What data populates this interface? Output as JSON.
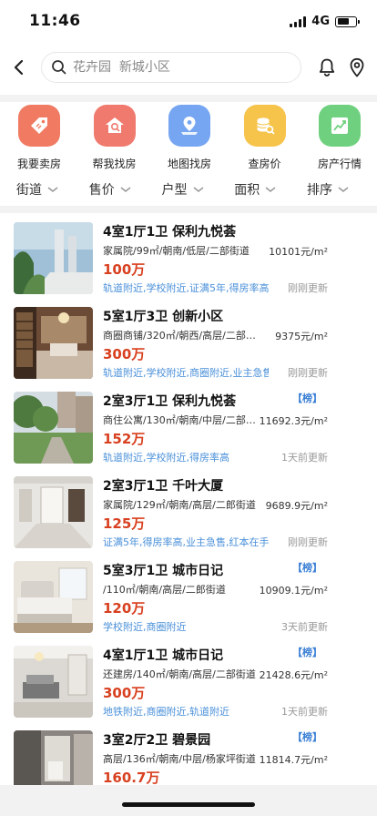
{
  "status_bar": {
    "time": "11:46",
    "network": "4G"
  },
  "header": {
    "search_placeholder": "花卉园  新城小区"
  },
  "categories": [
    {
      "label": "我要卖房",
      "icon": "sell-tag-icon",
      "color": "#f07a62"
    },
    {
      "label": "帮我找房",
      "icon": "house-search-icon",
      "color": "#f07a6e"
    },
    {
      "label": "地图找房",
      "icon": "map-pin-icon",
      "color": "#76a6f2"
    },
    {
      "label": "查房价",
      "icon": "coins-search-icon",
      "color": "#f6c34b"
    },
    {
      "label": "房产行情",
      "icon": "trend-chart-icon",
      "color": "#6fd17f"
    }
  ],
  "filters": [
    {
      "label": "街道"
    },
    {
      "label": "售价"
    },
    {
      "label": "户型"
    },
    {
      "label": "面积"
    },
    {
      "label": "排序"
    }
  ],
  "listings": [
    {
      "title": "4室1厅1卫  保利九悦荟",
      "details": "家属院/99㎡/朝南/低层/二部街道",
      "unit_price": "10101元/m²",
      "price": "100万",
      "tags": "轨道附近,学校附近,证满5年,得房率高",
      "updated": "刚刚更新",
      "rank": ""
    },
    {
      "title": "5室1厅3卫  创新小区",
      "details": "商圈商铺/320㎡/朝西/高层/二部街道",
      "unit_price": "9375元/m²",
      "price": "300万",
      "tags": "轨道附近,学校附近,商圈附近,业主急售",
      "updated": "刚刚更新",
      "rank": ""
    },
    {
      "title": "2室3厅1卫  保利九悦荟",
      "details": "商住公寓/130㎡/朝南/中层/二部街道",
      "unit_price": "11692.3元/m²",
      "price": "152万",
      "tags": "轨道附近,学校附近,得房率高",
      "updated": "1天前更新",
      "rank": "【榜】"
    },
    {
      "title": "2室3厅1卫  千叶大厦",
      "details": "家属院/129㎡/朝南/高层/二郎街道",
      "unit_price": "9689.9元/m²",
      "price": "125万",
      "tags": "证满5年,得房率高,业主急售,红本在手",
      "updated": "刚刚更新",
      "rank": ""
    },
    {
      "title": "5室3厅1卫  城市日记",
      "details": "/110㎡/朝南/高层/二郎街道",
      "unit_price": "10909.1元/m²",
      "price": "120万",
      "tags": "学校附近,商圈附近",
      "updated": "3天前更新",
      "rank": "【榜】"
    },
    {
      "title": "4室1厅1卫  城市日记",
      "details": "还建房/140㎡/朝南/高层/二部街道",
      "unit_price": "21428.6元/m²",
      "price": "300万",
      "tags": "地铁附近,商圈附近,轨道附近",
      "updated": "1天前更新",
      "rank": "【榜】"
    },
    {
      "title": "3室2厅2卫  碧景园",
      "details": "高层/136㎡/朝南/中层/杨家坪街道",
      "unit_price": "11814.7元/m²",
      "price": "160.7万",
      "tags": "",
      "updated": "",
      "rank": "【榜】"
    }
  ],
  "colors": {
    "price": "#d8401f",
    "tag": "#4a90d9",
    "rank": "#3a7fd5",
    "background_gray": "#f2f2f2"
  }
}
